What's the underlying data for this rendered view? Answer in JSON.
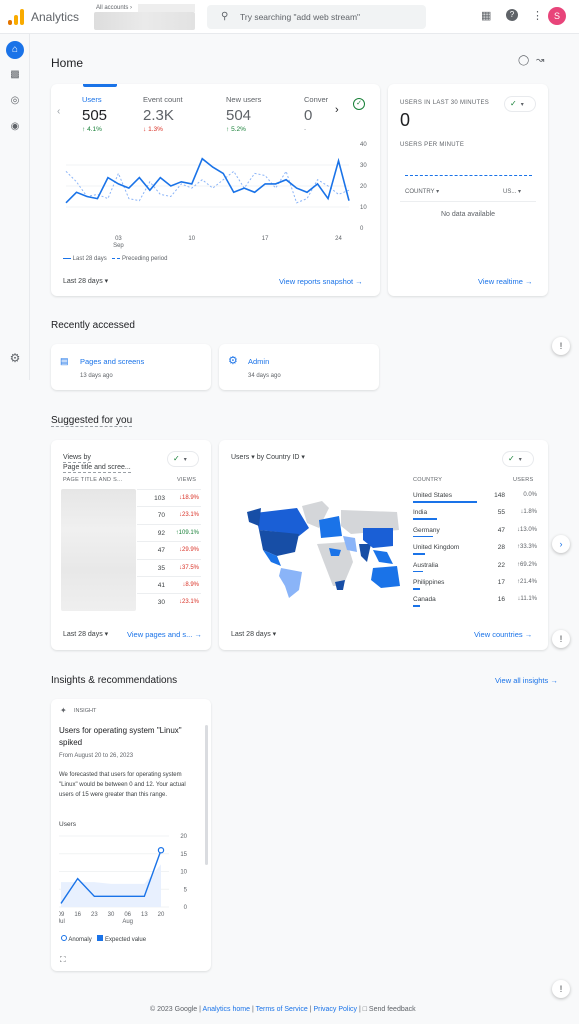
{
  "app": {
    "title": "Analytics",
    "accounts_label": "All accounts ›",
    "search_placeholder": "Try searching \"add web stream\"",
    "avatar_letter": "S"
  },
  "colors": {
    "accent": "#1a73e8",
    "up": "#188038",
    "down": "#d93025",
    "avatar": "#e8447a"
  },
  "nav": {
    "items": [
      "home-icon",
      "reports-icon",
      "explore-icon",
      "advertising-icon"
    ],
    "settings": "gear-icon"
  },
  "page": {
    "title": "Home"
  },
  "overview": {
    "metrics": [
      {
        "label": "Users",
        "value": "505",
        "change": "4.1%",
        "dir": "up"
      },
      {
        "label": "Event count",
        "value": "2.3K",
        "change": "1.3%",
        "dir": "down"
      },
      {
        "label": "New users",
        "value": "504",
        "change": "5.2%",
        "dir": "up"
      },
      {
        "label": "Conver",
        "value": "0",
        "change": "-",
        "dir": "none"
      }
    ],
    "date_range": "Last 28 days",
    "link": "View reports snapshot"
  },
  "chart_data": [
    {
      "type": "line",
      "title": "Users",
      "x_ticks": [
        {
          "day": 6,
          "label": "03",
          "sub": "Sep"
        },
        {
          "day": 13,
          "label": "10",
          "sub": ""
        },
        {
          "day": 20,
          "label": "17",
          "sub": ""
        },
        {
          "day": 27,
          "label": "24",
          "sub": ""
        }
      ],
      "y_ticks": [
        0,
        10,
        20,
        30,
        40
      ],
      "ylim": [
        0,
        40
      ],
      "series": [
        {
          "name": "Last 28 days",
          "style": "solid",
          "values": [
            12,
            17,
            15,
            14,
            24,
            21,
            19,
            24,
            18,
            24,
            20,
            22,
            21,
            33,
            29,
            26,
            17,
            19,
            17,
            21,
            21,
            23,
            19,
            17,
            21,
            14,
            32,
            13
          ]
        },
        {
          "name": "Preceding period",
          "style": "dashed",
          "values": [
            27,
            22,
            15,
            16,
            14,
            26,
            14,
            13,
            22,
            16,
            15,
            21,
            19,
            23,
            19,
            23,
            27,
            19,
            26,
            25,
            19,
            27,
            12,
            14,
            23,
            20,
            16,
            18
          ]
        }
      ],
      "legend": "bottom-left"
    },
    {
      "type": "line",
      "title": "Users",
      "x_ticks": [
        {
          "label": "09",
          "sub": "Jul"
        },
        {
          "label": "16",
          "sub": ""
        },
        {
          "label": "23",
          "sub": ""
        },
        {
          "label": "30",
          "sub": ""
        },
        {
          "label": "06",
          "sub": "Aug"
        },
        {
          "label": "13",
          "sub": ""
        },
        {
          "label": "20",
          "sub": ""
        }
      ],
      "y_ticks": [
        0,
        5,
        10,
        15,
        20
      ],
      "ylim": [
        0,
        20
      ],
      "series": [
        {
          "name": "Users",
          "values": [
            1,
            8,
            3,
            3,
            3,
            3,
            16
          ]
        },
        {
          "name": "Expected value",
          "values": [
            7,
            7,
            7,
            6.5,
            6.5,
            6.5,
            12
          ]
        }
      ],
      "anomaly_index": 6,
      "legend_items": [
        "Anomaly",
        "Expected value"
      ]
    }
  ],
  "realtime": {
    "title": "USERS IN LAST 30 MINUTES",
    "value": "0",
    "per_minute": "USERS PER MINUTE",
    "col_country": "COUNTRY",
    "col_users": "US...",
    "empty": "No data available",
    "link": "View realtime"
  },
  "recent": {
    "title": "Recently accessed",
    "items": [
      {
        "label": "Pages and screens",
        "time": "13 days ago",
        "icon": "report-icon"
      },
      {
        "label": "Admin",
        "time": "34 days ago",
        "icon": "gear-icon"
      }
    ]
  },
  "suggested": {
    "title": "Suggested for you",
    "pages_card": {
      "title1": "Views by",
      "title2": "Page title and scree...",
      "col1": "PAGE TITLE AND S...",
      "col2": "VIEWS",
      "rows": [
        {
          "value": "103",
          "change": "18.9%",
          "dir": "down"
        },
        {
          "value": "70",
          "change": "23.1%",
          "dir": "down"
        },
        {
          "value": "92",
          "change": "109.1%",
          "dir": "up"
        },
        {
          "value": "47",
          "change": "29.9%",
          "dir": "down"
        },
        {
          "value": "35",
          "change": "37.5%",
          "dir": "down"
        },
        {
          "value": "41",
          "change": "8.9%",
          "dir": "down"
        },
        {
          "value": "30",
          "change": "23.1%",
          "dir": "down"
        }
      ],
      "date_range": "Last 28 days",
      "link": "View pages and s..."
    },
    "country_card": {
      "metric": "Users",
      "dimension": "by Country ID",
      "col1": "COUNTRY",
      "col2": "USERS",
      "rows": [
        {
          "country": "United States",
          "value": "148",
          "change": "0.0%",
          "dir": "none",
          "share": 1.0
        },
        {
          "country": "India",
          "value": "55",
          "change": "1.8%",
          "dir": "down",
          "share": 0.37
        },
        {
          "country": "Germany",
          "value": "47",
          "change": "13.0%",
          "dir": "down",
          "share": 0.32
        },
        {
          "country": "United Kingdom",
          "value": "28",
          "change": "33.3%",
          "dir": "up",
          "share": 0.19
        },
        {
          "country": "Australia",
          "value": "22",
          "change": "69.2%",
          "dir": "up",
          "share": 0.15
        },
        {
          "country": "Philippines",
          "value": "17",
          "change": "21.4%",
          "dir": "up",
          "share": 0.11
        },
        {
          "country": "Canada",
          "value": "16",
          "change": "11.1%",
          "dir": "down",
          "share": 0.11
        }
      ],
      "date_range": "Last 28 days",
      "link": "View countries"
    }
  },
  "insights": {
    "title": "Insights & recommendations",
    "view_all": "View all insights",
    "card": {
      "tag": "INSIGHT",
      "headline": "Users for operating system \"Linux\" spiked",
      "dates": "From August 20 to 26, 2023",
      "body": "We forecasted that users for operating system \"Linux\" would be between 0 and 12. Your actual users of 15 were greater than this range.",
      "chart_title": "Users"
    }
  },
  "footer": {
    "copyright": "© 2023 Google |",
    "links": [
      "Analytics home",
      "Terms of Service",
      "Privacy Policy"
    ],
    "feedback": "Send feedback"
  }
}
